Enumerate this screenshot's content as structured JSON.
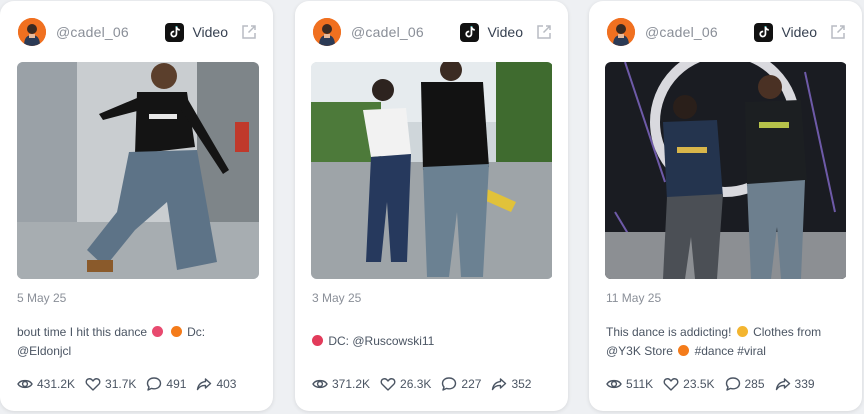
{
  "cards": [
    {
      "handle": "@cadel_06",
      "platform": "Video",
      "date": "5 May 25",
      "caption_pre": "bout time I hit this dance",
      "caption_mid": "Dc:",
      "caption_post": "@Eldonjcl",
      "views": "431.2K",
      "likes": "31.7K",
      "comments": "491",
      "shares": "403"
    },
    {
      "handle": "@cadel_06",
      "platform": "Video",
      "date": "3 May 25",
      "caption_pre": "DC: @Ruscowski11",
      "views": "371.2K",
      "likes": "26.3K",
      "comments": "227",
      "shares": "352"
    },
    {
      "handle": "@cadel_06",
      "platform": "Video",
      "date": "11 May 25",
      "caption_pre": "This dance is addicting!",
      "caption_mid": "Clothes from",
      "caption_post_a": "@Y3K Store",
      "caption_post_b": "#dance #viral",
      "views": "511K",
      "likes": "23.5K",
      "comments": "285",
      "shares": "339"
    }
  ],
  "icons": {
    "platform": "tiktok-icon",
    "external": "external-link-icon",
    "views": "eye-icon",
    "likes": "heart-icon",
    "comments": "comment-icon",
    "shares": "share-icon"
  },
  "colors": {
    "avatar": "#f07020",
    "fire_emoji": "#f47b1a",
    "heart_emoji": "#e23b5a",
    "shock_emoji": "#f3b530"
  }
}
